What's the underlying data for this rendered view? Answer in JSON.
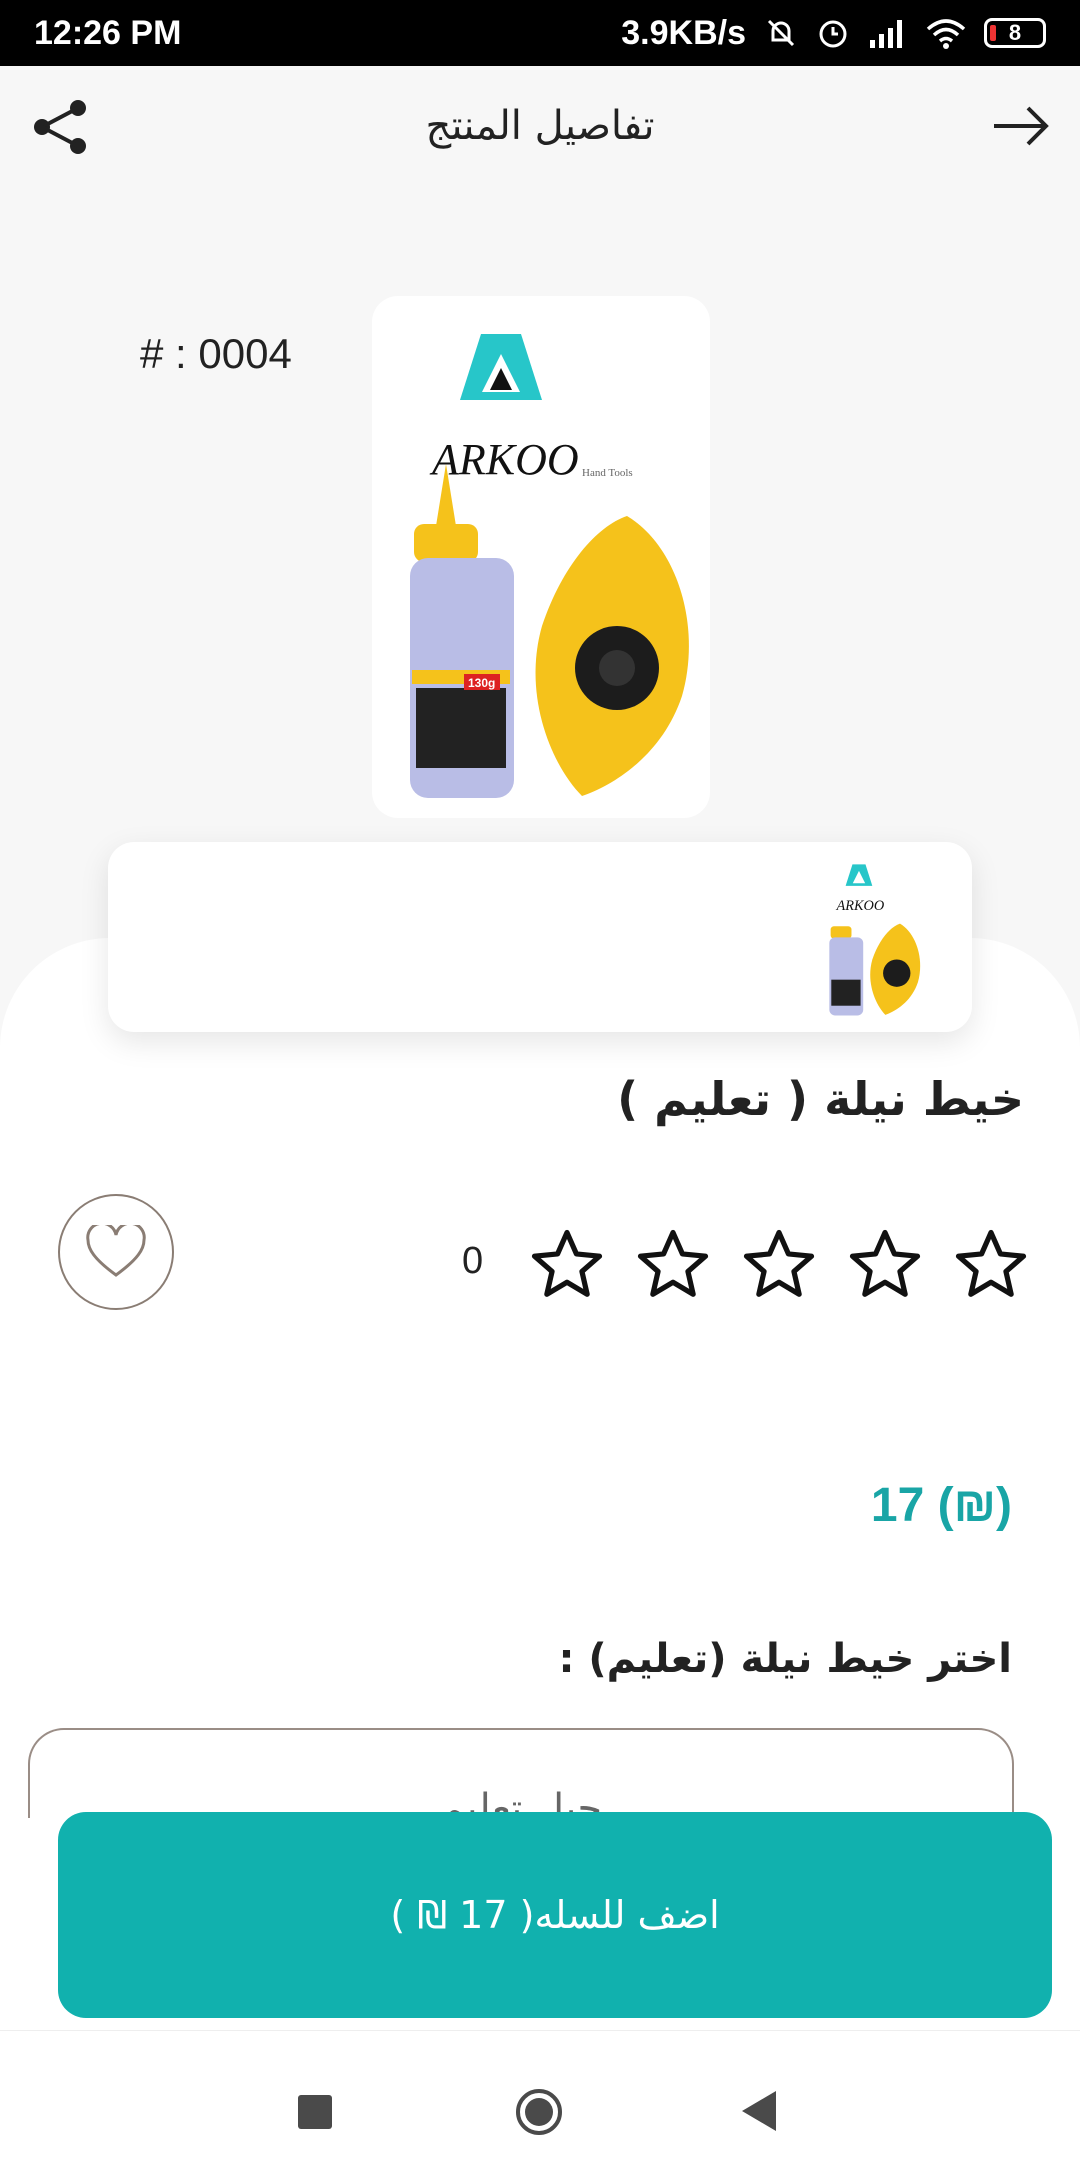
{
  "status_bar": {
    "time": "12:26 PM",
    "network_speed": "3.9KB/s",
    "battery": "8",
    "icons": [
      "mute-icon",
      "alarm-icon",
      "signal-icon",
      "wifi-icon",
      "battery-icon"
    ]
  },
  "header": {
    "title": "تفاصيل المنتج",
    "share_icon": "share-icon",
    "back_icon": "arrow-right-icon"
  },
  "product": {
    "code": "# : 0004",
    "brand": "ARKOO",
    "brand_sub": "Hand Tools",
    "package_label": "130g",
    "name": "خيط نيلة ( تعليم )",
    "rating_count": "0",
    "stars_total": 5,
    "stars_filled": 0,
    "price": "17 (₪)"
  },
  "options": {
    "label": "اختر خيط نيلة (تعليم) :",
    "selected_value": "حبل تعليم"
  },
  "cart": {
    "label": "اضف للسله( 17 ₪ )"
  },
  "colors": {
    "accent": "#11b1ae",
    "price": "#19a5a6",
    "product_yellow": "#f5c21b"
  }
}
